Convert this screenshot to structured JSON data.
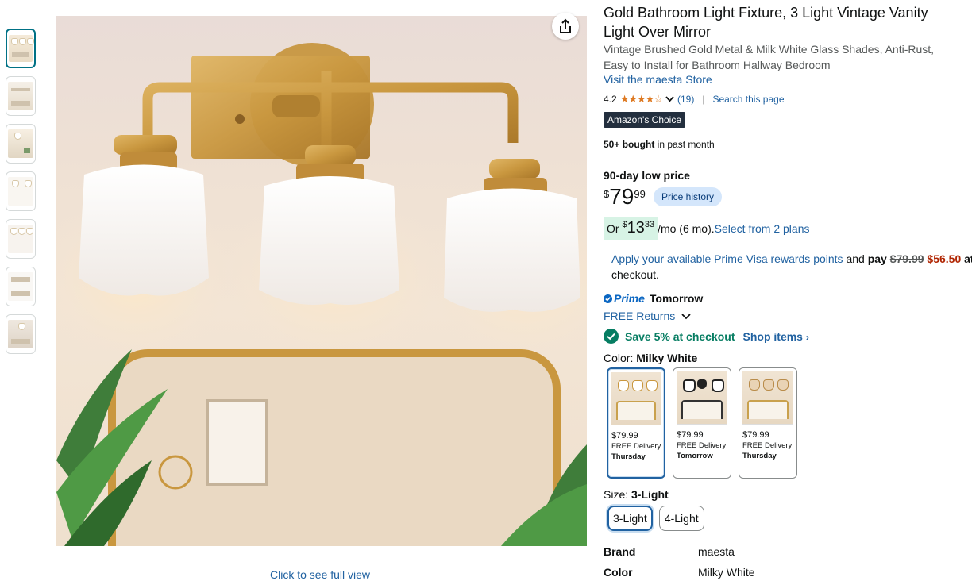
{
  "gallery": {
    "caption": "Click to see full view",
    "thumb_count": 7
  },
  "product": {
    "title": "Gold Bathroom Light Fixture, 3 Light Vintage Vanity Light Over Mirror",
    "subtitle": "Vintage Brushed Gold Metal & Milk White Glass Shades, Anti-Rust, Easy to Install for Bathroom Hallway Bedroom",
    "store_link": "Visit the maesta Store",
    "rating": "4.2",
    "stars": "★★★★☆",
    "review_count": "(19)",
    "search_page": "Search this page",
    "badge": "Amazon's Choice",
    "bought_bold": "50+ bought",
    "bought_rest": " in past month"
  },
  "pricing": {
    "low_label": "90-day low price",
    "currency": "$",
    "whole": "79",
    "fraction": "99",
    "history_btn": "Price history",
    "monthly_prefix": "Or ",
    "monthly_whole": "13",
    "monthly_fraction": "33",
    "monthly_suffix": "/mo (6 mo). ",
    "plans_link": "Select from 2 plans",
    "visa_link": "Apply your available Prime Visa rewards points ",
    "visa_and": "and ",
    "visa_pay": "pay",
    "visa_old": "$79.99",
    "visa_new": "$56.50",
    "visa_tail": " at",
    "visa_line2": "checkout."
  },
  "delivery": {
    "prime": "Prime",
    "prime_day": "Tomorrow",
    "returns": "FREE Returns",
    "save_text": "Save 5% at checkout",
    "shop_items": "Shop items"
  },
  "color": {
    "label": "Color: ",
    "selected": "Milky White",
    "options": [
      {
        "price": "$79.99",
        "delivery": "FREE Delivery",
        "day": "Thursday"
      },
      {
        "price": "$79.99",
        "delivery": "FREE Delivery",
        "day": "Tomorrow"
      },
      {
        "price": "$79.99",
        "delivery": "FREE Delivery",
        "day": "Thursday"
      }
    ]
  },
  "size": {
    "label": "Size: ",
    "selected": "3-Light",
    "options": [
      "3-Light",
      "4-Light"
    ]
  },
  "specs": [
    {
      "key": "Brand",
      "value": "maesta"
    },
    {
      "key": "Color",
      "value": "Milky White"
    }
  ]
}
